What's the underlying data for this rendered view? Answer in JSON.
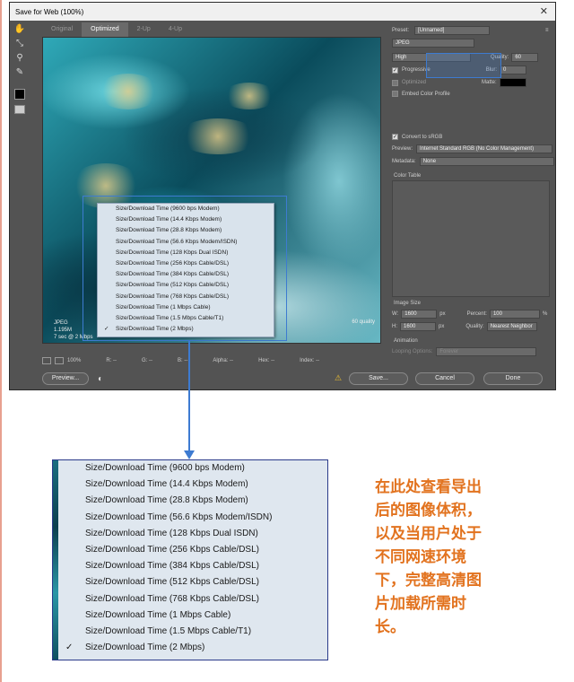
{
  "dialog": {
    "title": "Save for Web (100%)",
    "tabs": [
      "Original",
      "Optimized",
      "2-Up",
      "4-Up"
    ],
    "active_tab": "Optimized"
  },
  "preview": {
    "format": "JPEG",
    "size": "1.195M",
    "time": "7 sec @ 2 Mbps",
    "quality": "60 quality"
  },
  "download_menu": {
    "items": [
      "Size/Download Time (9600 bps Modem)",
      "Size/Download Time (14.4 Kbps Modem)",
      "Size/Download Time (28.8 Kbps Modem)",
      "Size/Download Time (56.6 Kbps Modem/ISDN)",
      "Size/Download Time (128 Kbps Dual ISDN)",
      "Size/Download Time (256 Kbps Cable/DSL)",
      "Size/Download Time (384 Kbps Cable/DSL)",
      "Size/Download Time (512 Kbps Cable/DSL)",
      "Size/Download Time (768 Kbps Cable/DSL)",
      "Size/Download Time (1 Mbps Cable)",
      "Size/Download Time (1.5 Mbps Cable/T1)",
      "Size/Download Time (2 Mbps)"
    ],
    "checked_index": 11,
    "check_glyph": "✓"
  },
  "bottombar": {
    "zoom": "100%",
    "r": "R: --",
    "g": "G: --",
    "b": "B: --",
    "alpha": "Alpha: --",
    "hex": "Hex: --",
    "index": "Index: --"
  },
  "buttons": {
    "preview": "Preview...",
    "save": "Save...",
    "cancel": "Cancel",
    "done": "Done"
  },
  "panel": {
    "preset_label": "Preset:",
    "preset_value": "[Unnamed]",
    "format": "JPEG",
    "quality_level": "High",
    "quality_label": "Quality:",
    "quality_value": "60",
    "blur_label": "Blur:",
    "blur_value": "0",
    "matte_label": "Matte:",
    "progressive": "Progressive",
    "optimized": "Optimized",
    "embed_profile": "Embed Color Profile",
    "convert_srgb": "Convert to sRGB",
    "preview_label": "Preview:",
    "preview_value": "Internet Standard RGB (No Color Management)",
    "metadata_label": "Metadata:",
    "metadata_value": "None",
    "color_table": "Color Table",
    "image_size": "Image Size",
    "w_label": "W:",
    "w_value": "1600",
    "h_label": "H:",
    "h_value": "1600",
    "px": "px",
    "percent_label": "Percent:",
    "percent_value": "100",
    "percent_unit": "%",
    "quality2_label": "Quality:",
    "quality2_value": "Nearest Neighbor",
    "animation": "Animation",
    "looping_label": "Looping Options:",
    "looping_value": "Forever"
  },
  "note": "在此处查看导出后的图像体积，以及当用户处于不同网速环境下，完整高清图片加载所需时长。",
  "colors": {
    "accent": "#3d7bd1",
    "note": "#e2731f"
  }
}
